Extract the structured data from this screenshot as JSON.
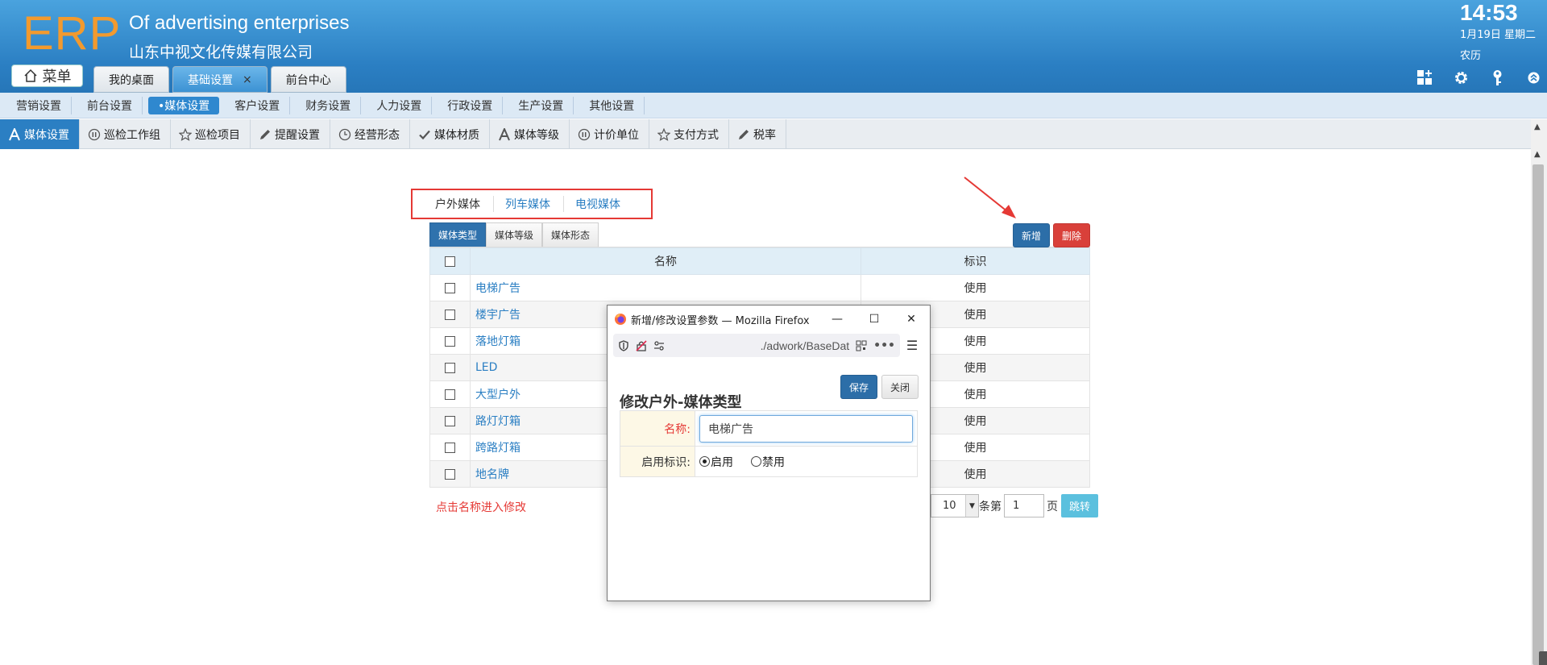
{
  "brand": {
    "logo": "ERP",
    "company_en": "Of advertising enterprises",
    "company_cn": "山东中视文化传媒有限公司"
  },
  "clock": {
    "time": "14:53",
    "date": "1月19日 星期二",
    "lunar": "农历"
  },
  "menu_button": "菜单",
  "top_tabs": [
    {
      "label": "我的桌面"
    },
    {
      "label": "基础设置",
      "close": "×"
    },
    {
      "label": "前台中心"
    }
  ],
  "subnav": [
    "营销设置",
    "前台设置",
    "•媒体设置",
    "客户设置",
    "财务设置",
    "人力设置",
    "行政设置",
    "生产设置",
    "其他设置"
  ],
  "tool_tabs": [
    "媒体设置",
    "巡检工作组",
    "巡检项目",
    "提醒设置",
    "经营形态",
    "媒体材质",
    "媒体等级",
    "计价单位",
    "支付方式",
    "税率"
  ],
  "media_tabs": [
    "户外媒体",
    "列车媒体",
    "电视媒体"
  ],
  "sub_tabs": [
    "媒体类型",
    "媒体等级",
    "媒体形态"
  ],
  "actions": {
    "add": "新增",
    "delete": "删除"
  },
  "table": {
    "headers": [
      "名称",
      "标识"
    ],
    "rows": [
      {
        "name": "电梯广告",
        "flag": "使用"
      },
      {
        "name": "楼宇广告",
        "flag": "使用"
      },
      {
        "name": "落地灯箱",
        "flag": "使用"
      },
      {
        "name": "LED",
        "flag": "使用"
      },
      {
        "name": "大型户外",
        "flag": "使用"
      },
      {
        "name": "路灯灯箱",
        "flag": "使用"
      },
      {
        "name": "跨路灯箱",
        "flag": "使用"
      },
      {
        "name": "地名牌",
        "flag": "使用"
      }
    ]
  },
  "hint": "点击名称进入修改",
  "pager": {
    "page_size": "10",
    "label_per": "条第",
    "page": "1",
    "label_page": "页",
    "jump": "跳转"
  },
  "popup": {
    "window_title": "新增/修改设置参数 — Mozilla Firefox",
    "url": "./adwork/BaseDat",
    "heading": "修改户外-媒体类型",
    "save": "保存",
    "close": "关闭",
    "name_label": "名称:",
    "name_value": "电梯广告",
    "flag_label": "启用标识:",
    "radio_on": "启用",
    "radio_off": "禁用"
  },
  "colors": {
    "header": "#2b7fc3",
    "logo": "#f29a2e",
    "primary": "#2c6ea8",
    "danger": "#d9403a",
    "highlight": "#e53935"
  }
}
